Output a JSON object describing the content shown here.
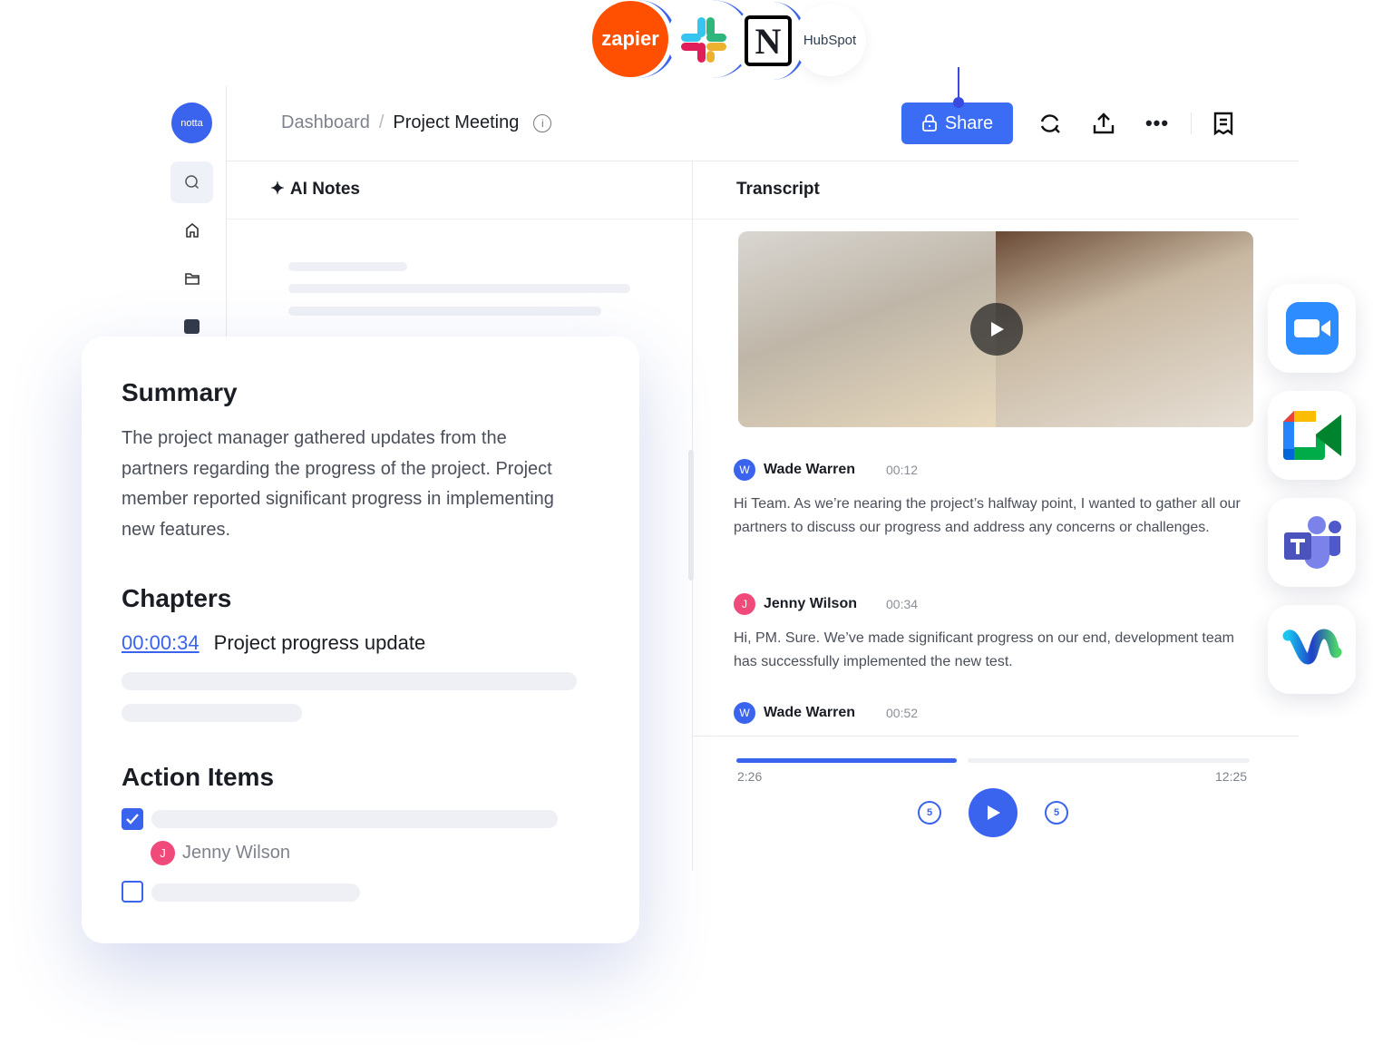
{
  "integrations_top": [
    {
      "name": "Zapier",
      "label": "zapier",
      "color": "#ff4f00"
    },
    {
      "name": "Slack",
      "label": ""
    },
    {
      "name": "Notion",
      "label": "N"
    },
    {
      "name": "HubSpot",
      "label": "HubSpot"
    }
  ],
  "sidebar": {
    "logo": "notta",
    "items": [
      {
        "icon": "search-icon"
      },
      {
        "icon": "home-icon"
      },
      {
        "icon": "folder-icon"
      },
      {
        "icon": "calendar-icon"
      }
    ]
  },
  "header": {
    "breadcrumb": {
      "root": "Dashboard",
      "separator": "/",
      "current": "Project Meeting"
    },
    "share_label": "Share"
  },
  "notes_panel": {
    "title": "AI Notes"
  },
  "transcript_panel": {
    "title": "Transcript"
  },
  "summary_card": {
    "summary_title": "Summary",
    "summary_text": "The project manager gathered updates from the partners regarding the progress of the project. Project member reported significant progress in implementing new features.",
    "chapters_title": "Chapters",
    "chapter": {
      "time": "00:00:34",
      "title": "Project progress update"
    },
    "action_title": "Action Items",
    "action_items": [
      {
        "checked": true,
        "assignee": "Jenny Wilson",
        "assignee_initial": "J"
      },
      {
        "checked": false
      }
    ]
  },
  "transcript": [
    {
      "initial": "W",
      "speaker": "Wade Warren",
      "time": "00:12",
      "text": "Hi Team. As we’re nearing the project’s halfway point, I wanted to gather all our partners to discuss our progress and address any concerns or challenges.",
      "color": "#3a63ee"
    },
    {
      "initial": "J",
      "speaker": "Jenny Wilson",
      "time": "00:34",
      "text": "Hi, PM. Sure. We’ve made significant progress on our end, development team has successfully implemented the new test.",
      "color": "#ef4a7a"
    },
    {
      "initial": "W",
      "speaker": "Wade Warren",
      "time": "00:52",
      "color": "#3a63ee"
    }
  ],
  "player": {
    "current": "2:26",
    "total": "12:25",
    "progress": 0.43,
    "skip_seconds": "5"
  },
  "integrations_side": [
    "Zoom",
    "Google Meet",
    "Microsoft Teams",
    "Webex"
  ],
  "colors": {
    "accent": "#3a63ee"
  }
}
